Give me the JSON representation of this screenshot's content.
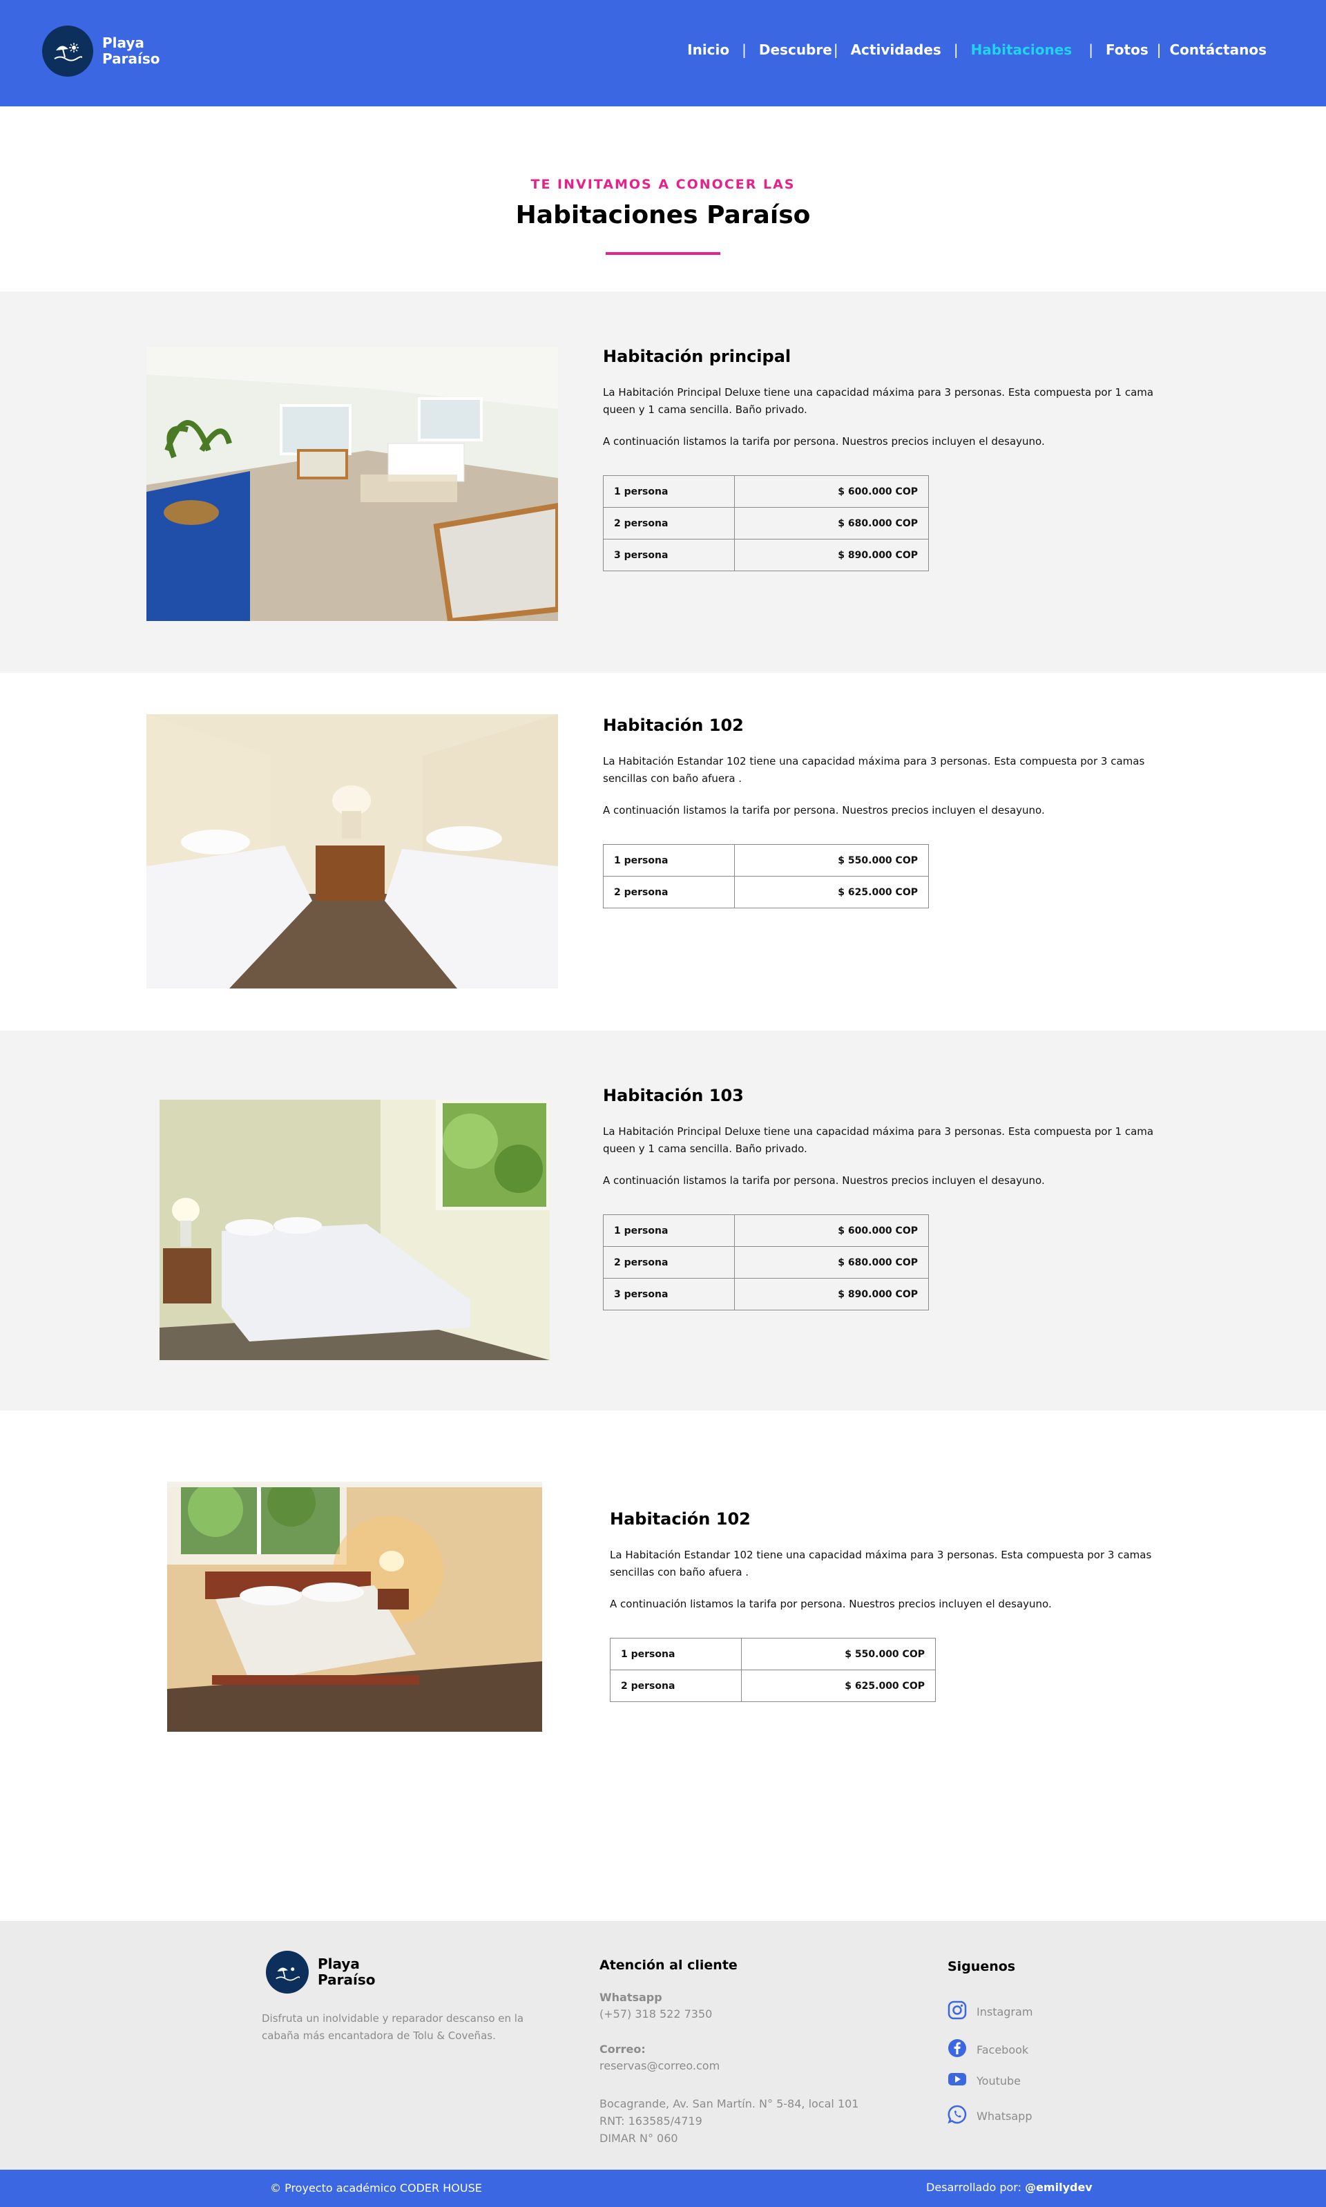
{
  "brand": {
    "line1": "Playa",
    "line2": "Paraíso"
  },
  "nav": {
    "items": [
      {
        "label": "Inicio"
      },
      {
        "label": "Descubre"
      },
      {
        "label": "Actividades"
      },
      {
        "label": "Habitaciones"
      },
      {
        "label": "Fotos"
      },
      {
        "label": "Contáctanos"
      }
    ],
    "separator": "|",
    "active_color": "#22d3ee"
  },
  "intro": {
    "eyebrow": "TE INVITAMOS A CONOCER LAS",
    "title": "Habitaciones Paraíso"
  },
  "rooms": [
    {
      "title": "Habitación principal",
      "description": "La Habitación Principal Deluxe tiene una capacidad máxima para 3 personas. Esta compuesta por 1 cama queen y 1 cama sencilla. Baño privado.",
      "note": "A continuación listamos la tarifa por persona. Nuestros precios incluyen el desayuno.",
      "rates": [
        {
          "label": "1 persona",
          "price": "$ 600.000 COP"
        },
        {
          "label": "2 persona",
          "price": "$ 680.000 COP"
        },
        {
          "label": "3 persona",
          "price": "$ 890.000 COP"
        }
      ]
    },
    {
      "title": "Habitación 102",
      "description": "La Habitación Estandar 102 tiene una capacidad máxima para 3 personas. Esta compuesta por 3 camas sencillas con baño afuera .",
      "note": "A continuación listamos la tarifa por persona. Nuestros precios incluyen el desayuno.",
      "rates": [
        {
          "label": "1 persona",
          "price": "$ 550.000 COP"
        },
        {
          "label": "2 persona",
          "price": "$ 625.000 COP"
        }
      ]
    },
    {
      "title": "Habitación 103",
      "description": "La Habitación Principal Deluxe tiene una capacidad máxima para 3 personas. Esta compuesta por 1 cama queen y 1 cama sencilla. Baño privado.",
      "note": "A continuación listamos la tarifa por persona. Nuestros precios incluyen el desayuno.",
      "rates": [
        {
          "label": "1 persona",
          "price": "$ 600.000 COP"
        },
        {
          "label": "2 persona",
          "price": "$ 680.000 COP"
        },
        {
          "label": "3 persona",
          "price": "$ 890.000 COP"
        }
      ]
    },
    {
      "title": "Habitación 102",
      "description": "La Habitación Estandar 102 tiene una capacidad máxima para 3 personas. Esta compuesta por 3 camas sencillas con baño afuera .",
      "note": "A continuación listamos la tarifa por persona. Nuestros precios incluyen el desayuno.",
      "rates": [
        {
          "label": "1 persona",
          "price": "$ 550.000 COP"
        },
        {
          "label": "2 persona",
          "price": "$ 625.000 COP"
        }
      ]
    }
  ],
  "footer": {
    "brand": {
      "line1": "Playa",
      "line2": "Paraíso"
    },
    "description": "Disfruta un inolvidable y reparador descanso en la cabaña más encantadora de Tolu & Coveñas.",
    "support": {
      "title": "Atención al cliente",
      "whatsapp_label": "Whatsapp",
      "whatsapp_value": "(+57) 318 522 7350",
      "email_label": "Correo:",
      "email_value": "reservas@correo.com",
      "address": "Bocagrande, Av. San Martín. N° 5-84, local 101",
      "rnt": "RNT: 163585/4719",
      "dimar": "DIMAR N° 060"
    },
    "social": {
      "title": "Siguenos",
      "items": [
        {
          "name": "Instagram",
          "icon": "instagram-icon"
        },
        {
          "name": "Facebook",
          "icon": "facebook-icon"
        },
        {
          "name": "Youtube",
          "icon": "youtube-icon"
        },
        {
          "name": "Whatsapp",
          "icon": "whatsapp-icon"
        }
      ]
    },
    "bottom_left": "© Proyecto académico CODER HOUSE",
    "bottom_right_prefix": "Desarrollado por:",
    "bottom_right_author": "@emilydev"
  },
  "colors": {
    "header_bg": "#3c67e3",
    "accent_pink": "#e6228a",
    "logo_bg": "#0c2f5c",
    "section_gray": "#f3f3f3",
    "footer_bg": "#ebebeb"
  }
}
